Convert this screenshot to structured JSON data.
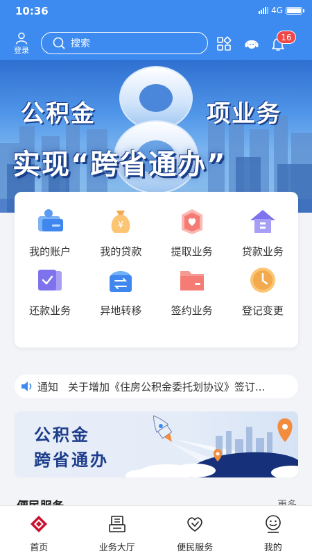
{
  "status_bar": {
    "time": "10:36",
    "network": "4G"
  },
  "header": {
    "login_label": "登录",
    "search_placeholder": "搜索",
    "notification_count": "16",
    "accent_color": "#3d8bf0"
  },
  "banner": {
    "line1_left": "公积金",
    "big_number": "8",
    "line1_right": "项业务",
    "line2": "实现“跨省通办”"
  },
  "services": [
    {
      "label": "我的账户",
      "icon": "account-card-icon"
    },
    {
      "label": "我的贷款",
      "icon": "money-bag-icon"
    },
    {
      "label": "提取业务",
      "icon": "heart-box-icon"
    },
    {
      "label": "贷款业务",
      "icon": "house-icon"
    },
    {
      "label": "还款业务",
      "icon": "check-document-icon"
    },
    {
      "label": "异地转移",
      "icon": "transfer-arrows-icon"
    },
    {
      "label": "签约业务",
      "icon": "folder-icon"
    },
    {
      "label": "登记变更",
      "icon": "clock-icon"
    }
  ],
  "notice": {
    "label": "通知",
    "text": "关于增加《住房公积金委托划协议》签订..."
  },
  "promo": {
    "line1": "公积金",
    "line2": "跨省通办"
  },
  "section": {
    "title": "便民服务",
    "more": "更多"
  },
  "bottom_nav": [
    {
      "label": "首页",
      "icon": "home-logo-icon",
      "active": true
    },
    {
      "label": "业务大厅",
      "icon": "service-hall-icon",
      "active": false
    },
    {
      "label": "便民服务",
      "icon": "heart-hand-icon",
      "active": false
    },
    {
      "label": "我的",
      "icon": "smile-face-icon",
      "active": false
    }
  ]
}
